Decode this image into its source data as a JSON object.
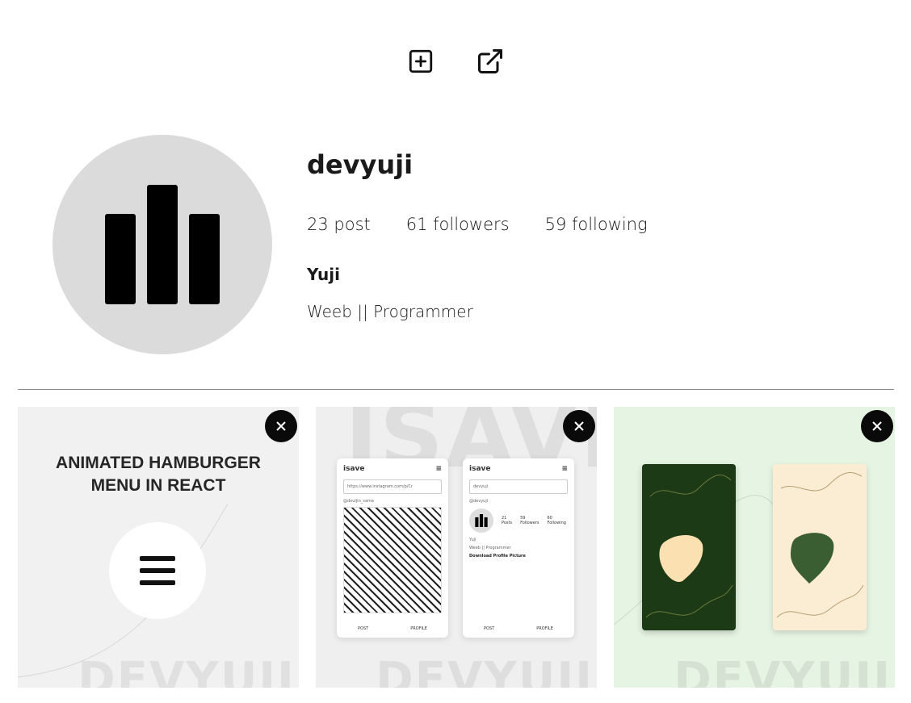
{
  "profile": {
    "username": "devyuji",
    "posts": "23 post",
    "followers": "61 followers",
    "following": "59 following",
    "full_name": "Yuji",
    "bio": "Weeb || Programmer"
  },
  "actions": {
    "add_icon": "plus-square-icon",
    "share_icon": "external-link-icon"
  },
  "posts": [
    {
      "title_line1": "ANIMATED HAMBURGER",
      "title_line2": "MENU IN REACT",
      "watermark": "DEVYUJI"
    },
    {
      "big_watermark": "ISAVE",
      "watermark": "DEVYUJI",
      "left_phone": {
        "app": "isave",
        "url": "https://www.instagram.com/p/Cr",
        "account": "@douijin_sama",
        "post": "POST",
        "profile": "PROFILE"
      },
      "right_phone": {
        "app": "isave",
        "query": "devyuji",
        "account": "@devyuji",
        "posts": "21",
        "posts_label": "Posts",
        "followers": "59",
        "followers_label": "Followers",
        "following": "60",
        "following_label": "Following",
        "name": "Yuji",
        "bio": "Weeb || Programmer",
        "download": "Download Profile Picture",
        "post": "POST",
        "profile": "PROFILE"
      }
    },
    {
      "watermark": "DEVYUJI"
    }
  ],
  "colors": {
    "avatar_bg": "#dcdbdc",
    "dark_green": "#1d3a16",
    "cream": "#fbecd4",
    "mint": "#e6f4e3"
  }
}
